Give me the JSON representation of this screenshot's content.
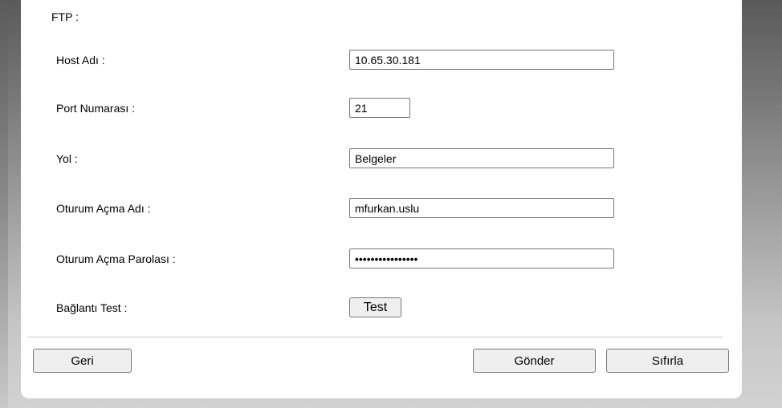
{
  "section_title": "FTP :",
  "fields": {
    "host": {
      "label": "Host Adı :",
      "value": "10.65.30.181"
    },
    "port": {
      "label": "Port Numarası :",
      "value": "21"
    },
    "path": {
      "label": "Yol :",
      "value": "Belgeler"
    },
    "username": {
      "label": "Oturum Açma Adı :",
      "value": "mfurkan.uslu"
    },
    "password": {
      "label": "Oturum Açma Parolası :",
      "value": "••••••••••••••••"
    },
    "connection_test": {
      "label": "Bağlantı Test :",
      "button_label": "Test"
    }
  },
  "buttons": {
    "back": "Geri",
    "send": "Gönder",
    "reset": "Sıfırla"
  }
}
